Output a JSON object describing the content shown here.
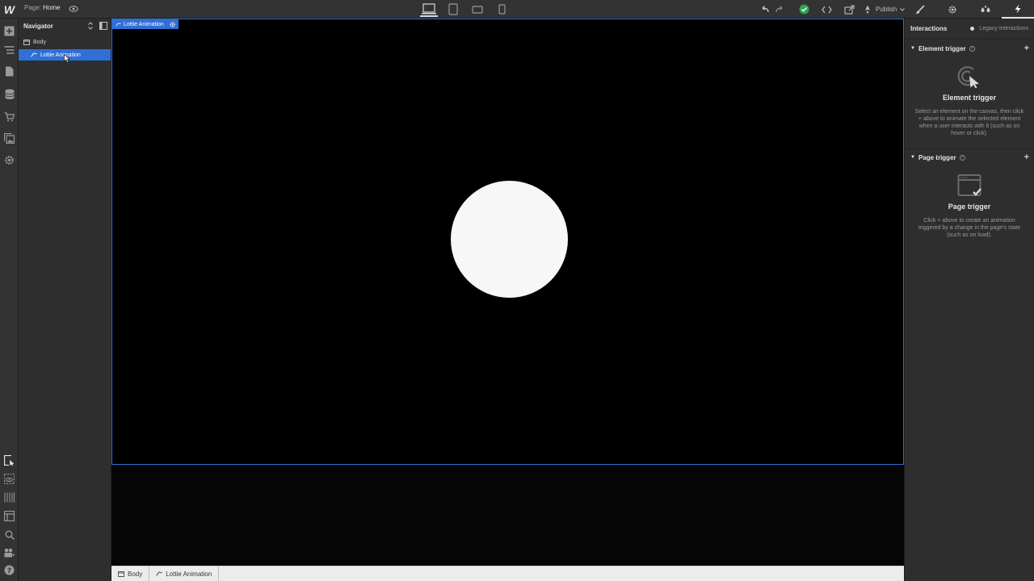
{
  "topbar": {
    "logo": "W",
    "page_prefix": "Page:",
    "page_name": "Home",
    "publish_label": "Publish",
    "devices": [
      "desktop-icon",
      "tablet-icon",
      "mobile-landscape-icon",
      "mobile-portrait-icon"
    ]
  },
  "navigator": {
    "title": "Navigator",
    "items": [
      {
        "label": "Body",
        "icon": "body-box-icon"
      },
      {
        "label": "Lottie Animation",
        "icon": "lottie-icon",
        "selected": true
      }
    ]
  },
  "canvas": {
    "selected_tag": "Lottie Animation",
    "background": "#000000",
    "circle_color": "#f7f7f7",
    "accent": "#2f6fd6"
  },
  "breadcrumb": {
    "items": [
      "Body",
      "Lottie Animation"
    ]
  },
  "right_panel": {
    "title": "Interactions",
    "legacy_label": "Legacy Interactions",
    "sections": [
      {
        "header": "Element trigger",
        "title": "Element trigger",
        "description": "Select an element on the canvas, then click + above to animate the selected element when a user interacts with it (such as on hover or click).",
        "icon": "element-trigger-cursor-icon"
      },
      {
        "header": "Page trigger",
        "title": "Page trigger",
        "description": "Click + above to create an animation triggered by a change in the page's state (such as on load).",
        "icon": "page-trigger-window-icon"
      }
    ]
  }
}
